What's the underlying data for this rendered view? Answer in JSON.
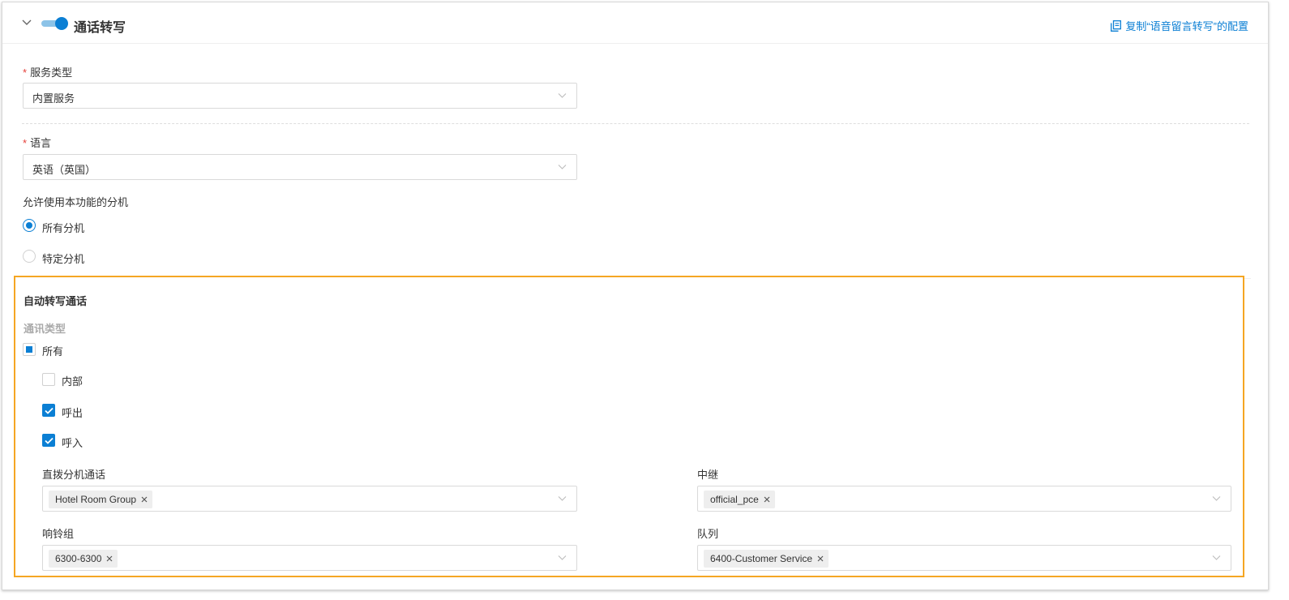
{
  "header": {
    "title": "通话转写",
    "enabled": true,
    "copy_link": "复制“语音留言转写”的配置"
  },
  "service_type": {
    "label": "服务类型",
    "value": "内置服务"
  },
  "language": {
    "label": "语言",
    "value": "英语（英国）"
  },
  "extensions": {
    "label": "允许使用本功能的分机",
    "options": [
      {
        "label": "所有分机",
        "checked": true
      },
      {
        "label": "特定分机",
        "checked": false
      }
    ]
  },
  "auto_transcribe": {
    "title": "自动转写通话",
    "comm_type_label": "通讯类型",
    "all": {
      "label": "所有",
      "state": "indeterminate"
    },
    "types": [
      {
        "label": "内部",
        "checked": false
      },
      {
        "label": "呼出",
        "checked": true
      },
      {
        "label": "呼入",
        "checked": true
      }
    ],
    "fields": {
      "direct": {
        "label": "直拨分机通话",
        "tag": "Hotel Room Group"
      },
      "trunk": {
        "label": "中继",
        "tag": "official_pce"
      },
      "ring_group": {
        "label": "响铃组",
        "tag": "6300-6300"
      },
      "queue": {
        "label": "队列",
        "tag": "6400-Customer Service"
      }
    }
  },
  "colors": {
    "accent": "#0b7fd4",
    "highlight": "#f5a623",
    "required": "#e5403a"
  }
}
